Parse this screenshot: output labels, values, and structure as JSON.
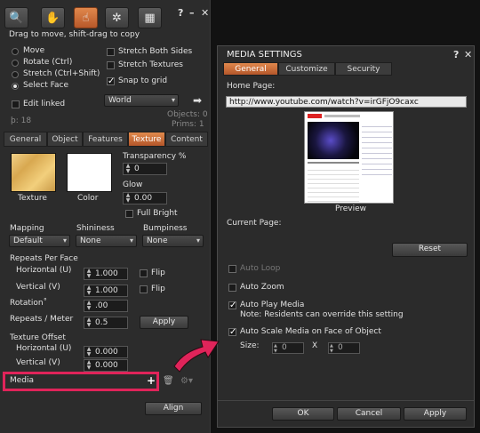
{
  "build": {
    "hint": "Drag to move, shift-drag to copy",
    "controls": {
      "help": "?",
      "minimize": "–",
      "close": "✕"
    },
    "modes": [
      {
        "label": "Move",
        "selected": false
      },
      {
        "label": "Rotate (Ctrl)",
        "selected": false
      },
      {
        "label": "Stretch (Ctrl+Shift)",
        "selected": false
      },
      {
        "label": "Select Face",
        "selected": true
      }
    ],
    "stretch_both": "Stretch Both Sides",
    "stretch_textures": "Stretch Textures",
    "snap_to_grid": "Snap to grid",
    "edit_linked": "Edit linked",
    "grid_mode": "World",
    "objects_count": "Objects: 0",
    "prims_count": "Prims: 1",
    "land_impact": "þ: 18",
    "tabs": [
      "General",
      "Object",
      "Features",
      "Texture",
      "Content"
    ],
    "active_tab": "Texture",
    "texture_label": "Texture",
    "color_label": "Color",
    "transparency_label": "Transparency %",
    "transparency_value": "0",
    "glow_label": "Glow",
    "glow_value": "0.00",
    "full_bright": "Full Bright",
    "mapping_label": "Mapping",
    "mapping_value": "Default",
    "shininess_label": "Shininess",
    "shininess_value": "None",
    "bumpiness_label": "Bumpiness",
    "bumpiness_value": "None",
    "repeats_per_face": "Repeats Per Face",
    "horizontal_label": "Horizontal (U)",
    "horizontal_value": "1.000",
    "vertical_label": "Vertical (V)",
    "vertical_value": "1.000",
    "flip": "Flip",
    "rotation_label": "Rotation˚",
    "rotation_value": ".00",
    "repeats_meter_label": "Repeats / Meter",
    "repeats_meter_value": "0.5",
    "apply": "Apply",
    "texture_offset": "Texture Offset",
    "offset_h_value": "0.000",
    "offset_v_value": "0.000",
    "media_label": "Media",
    "media_add": "+",
    "align": "Align"
  },
  "media": {
    "title": "MEDIA SETTINGS",
    "controls": {
      "help": "?",
      "close": "✕"
    },
    "tabs": [
      "General",
      "Customize",
      "Security"
    ],
    "active_tab": "General",
    "home_page_label": "Home Page:",
    "home_page_url": "http://www.youtube.com/watch?v=irGFjO9caxc",
    "preview_label": "Preview",
    "current_page_label": "Current Page:",
    "reset": "Reset",
    "auto_loop": "Auto Loop",
    "auto_zoom": "Auto Zoom",
    "auto_play": "Auto Play Media",
    "auto_play_note": "Note: Residents can override this setting",
    "auto_scale": "Auto Scale Media on Face of Object",
    "size_label": "Size:",
    "size_w": "0",
    "size_x": "X",
    "size_h": "0",
    "ok": "OK",
    "cancel": "Cancel",
    "apply": "Apply"
  },
  "colors": {
    "accent": "#e0245a",
    "tab_active": "#c86a36",
    "panel": "#2c2c2c"
  }
}
